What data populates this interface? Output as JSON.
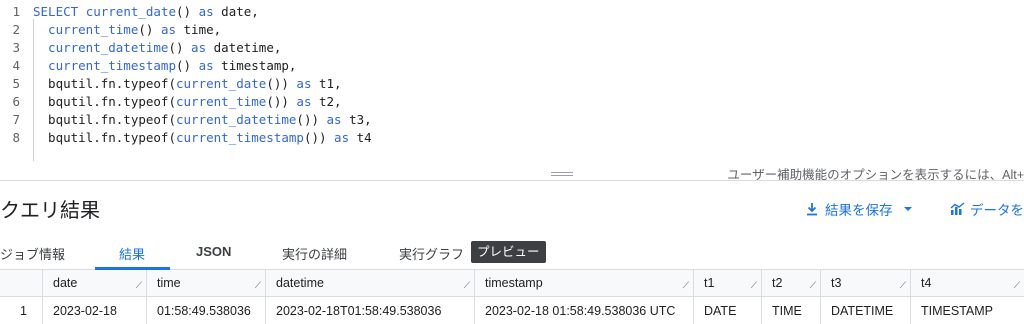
{
  "editor": {
    "lines": [
      {
        "no": "1",
        "tokens": [
          {
            "t": "SELECT ",
            "c": "kw"
          },
          {
            "t": "current_date",
            "c": "fn"
          },
          {
            "t": "() ",
            "c": "plain"
          },
          {
            "t": "as",
            "c": "kw"
          },
          {
            "t": " date,",
            "c": "plain"
          }
        ]
      },
      {
        "no": "2",
        "tokens": [
          {
            "t": "  current_time",
            "c": "fn"
          },
          {
            "t": "() ",
            "c": "plain"
          },
          {
            "t": "as",
            "c": "kw"
          },
          {
            "t": " time,",
            "c": "plain"
          }
        ]
      },
      {
        "no": "3",
        "tokens": [
          {
            "t": "  current_datetime",
            "c": "fn"
          },
          {
            "t": "() ",
            "c": "plain"
          },
          {
            "t": "as",
            "c": "kw"
          },
          {
            "t": " datetime,",
            "c": "plain"
          }
        ]
      },
      {
        "no": "4",
        "tokens": [
          {
            "t": "  current_timestamp",
            "c": "fn"
          },
          {
            "t": "() ",
            "c": "plain"
          },
          {
            "t": "as",
            "c": "kw"
          },
          {
            "t": " timestamp,",
            "c": "plain"
          }
        ]
      },
      {
        "no": "5",
        "tokens": [
          {
            "t": "  bqutil.fn.typeof(",
            "c": "plain"
          },
          {
            "t": "current_date",
            "c": "fn"
          },
          {
            "t": "()) ",
            "c": "plain"
          },
          {
            "t": "as",
            "c": "kw"
          },
          {
            "t": " t1,",
            "c": "plain"
          }
        ]
      },
      {
        "no": "6",
        "tokens": [
          {
            "t": "  bqutil.fn.typeof(",
            "c": "plain"
          },
          {
            "t": "current_time",
            "c": "fn"
          },
          {
            "t": "()) ",
            "c": "plain"
          },
          {
            "t": "as",
            "c": "kw"
          },
          {
            "t": " t2,",
            "c": "plain"
          }
        ]
      },
      {
        "no": "7",
        "tokens": [
          {
            "t": "  bqutil.fn.typeof(",
            "c": "plain"
          },
          {
            "t": "current_datetime",
            "c": "fn"
          },
          {
            "t": "()) ",
            "c": "plain"
          },
          {
            "t": "as",
            "c": "kw"
          },
          {
            "t": " t3,",
            "c": "plain"
          }
        ]
      },
      {
        "no": "8",
        "tokens": [
          {
            "t": "  bqutil.fn.typeof(",
            "c": "plain"
          },
          {
            "t": "current_timestamp",
            "c": "fn"
          },
          {
            "t": "()) ",
            "c": "plain"
          },
          {
            "t": "as",
            "c": "kw"
          },
          {
            "t": " t4",
            "c": "plain"
          }
        ]
      }
    ],
    "accessibility_hint": "ユーザー補助機能のオプションを表示するには、Alt+"
  },
  "results": {
    "title": "クエリ結果",
    "save_label": "結果を保存",
    "explore_label": "データを"
  },
  "tabs": [
    {
      "label": "ジョブ情報",
      "active": false
    },
    {
      "label": "結果",
      "active": true
    },
    {
      "label": "JSON",
      "active": false
    },
    {
      "label": "実行の詳細",
      "active": false
    },
    {
      "label": "実行グラフ",
      "active": false
    }
  ],
  "preview_badge": "プレビュー",
  "table": {
    "columns": [
      "date",
      "time",
      "datetime",
      "timestamp",
      "t1",
      "t2",
      "t3",
      "t4"
    ],
    "rows": [
      {
        "row_no": "1",
        "cells": [
          "2023-02-18",
          "01:58:49.538036",
          "2023-02-18T01:58:49.538036",
          "2023-02-18 01:58:49.538036 UTC",
          "DATE",
          "TIME",
          "DATETIME",
          "TIMESTAMP"
        ]
      }
    ]
  },
  "colors": {
    "keyword": "#3367d6",
    "accent": "#1a73e8",
    "badge_bg": "#3c4043"
  },
  "icons": {
    "save": "download-icon",
    "dropdown": "caret-down-icon",
    "explore": "chart-icon"
  }
}
